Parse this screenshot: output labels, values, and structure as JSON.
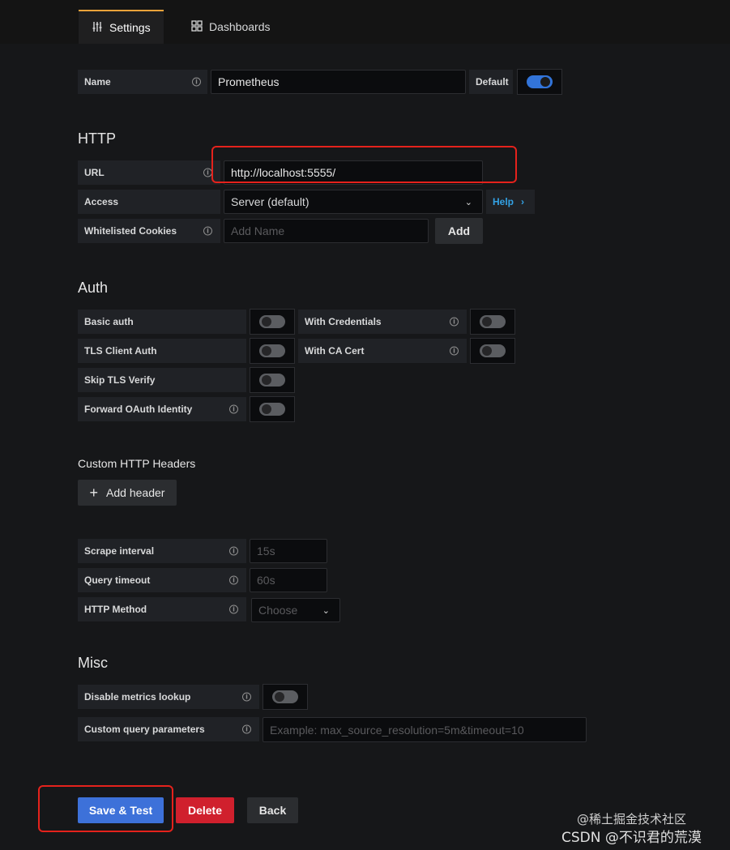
{
  "tabs": [
    {
      "label": "Settings",
      "icon": "sliders-icon",
      "active": true
    },
    {
      "label": "Dashboards",
      "icon": "grid-icon",
      "active": false
    }
  ],
  "name_row": {
    "label": "Name",
    "value": "Prometheus",
    "default_label": "Default",
    "default_on": true
  },
  "http": {
    "title": "HTTP",
    "url_label": "URL",
    "url_value": "http://localhost:5555/",
    "access_label": "Access",
    "access_value": "Server (default)",
    "help_label": "Help",
    "cookies_label": "Whitelisted Cookies",
    "cookies_placeholder": "Add Name",
    "add_label": "Add"
  },
  "auth": {
    "title": "Auth",
    "basic_auth": "Basic auth",
    "with_credentials": "With Credentials",
    "tls_client_auth": "TLS Client Auth",
    "with_ca_cert": "With CA Cert",
    "skip_tls_verify": "Skip TLS Verify",
    "forward_oauth": "Forward OAuth Identity"
  },
  "custom_headers": {
    "title": "Custom HTTP Headers",
    "add_header_label": "Add header"
  },
  "prom": {
    "scrape_label": "Scrape interval",
    "scrape_placeholder": "15s",
    "timeout_label": "Query timeout",
    "timeout_placeholder": "60s",
    "method_label": "HTTP Method",
    "method_placeholder": "Choose"
  },
  "misc": {
    "title": "Misc",
    "disable_metrics_label": "Disable metrics lookup",
    "custom_query_label": "Custom query parameters",
    "custom_query_placeholder": "Example: max_source_resolution=5m&timeout=10"
  },
  "actions": {
    "save_test": "Save & Test",
    "delete": "Delete",
    "back": "Back"
  },
  "watermark": {
    "line1": "@稀土掘金技术社区",
    "line2": "CSDN @不识君的荒漠"
  },
  "colors": {
    "accent": "#3274d9",
    "danger": "#d0202d",
    "tab_highlight": "#f0a33a",
    "annotation": "#e5221c"
  }
}
